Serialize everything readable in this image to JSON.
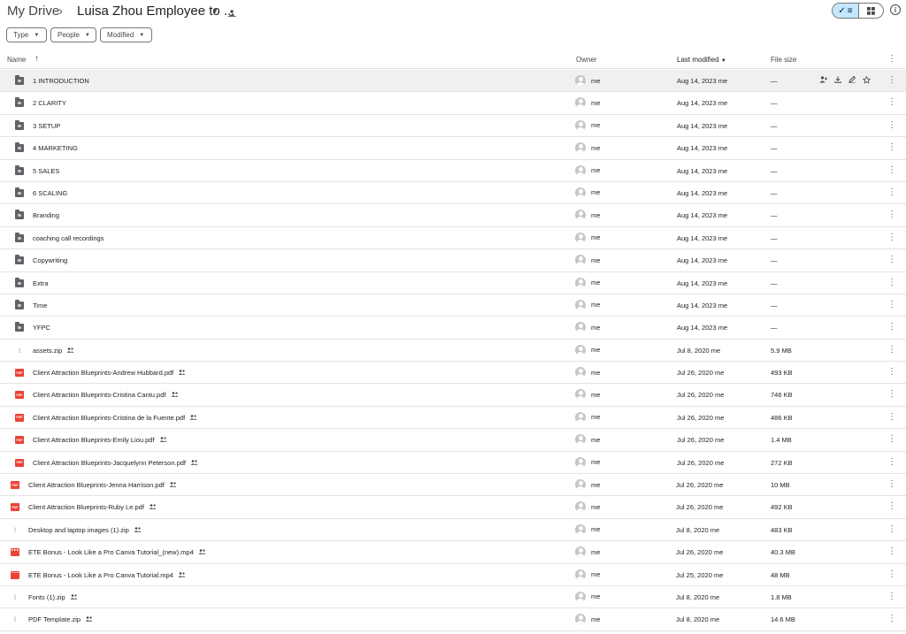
{
  "breadcrumb": {
    "root": "My Drive",
    "separator": "›",
    "current": "Luisa Zhou Employee to ..."
  },
  "filters": {
    "type": "Type",
    "people": "People",
    "modified": "Modified"
  },
  "columns": {
    "name": "Name",
    "owner": "Owner",
    "last_modified": "Last modified",
    "file_size": "File size"
  },
  "icons": {
    "sort_arrow": "arrow-up-icon",
    "more": "more-vert-icon",
    "shared": "shared-people-icon",
    "info": "info-icon"
  },
  "colors": {
    "accent": "#c2e7ff",
    "pdf_red": "#ea4335",
    "folder_gray": "#5f6368"
  },
  "rows": [
    {
      "type": "folder",
      "name": "1 INTRODUCTION",
      "owner": "me",
      "modified": "Aug 14, 2023 me",
      "size": "—",
      "shared": false
    },
    {
      "type": "folder",
      "name": "2 CLARITY",
      "owner": "me",
      "modified": "Aug 14, 2023 me",
      "size": "—",
      "shared": false
    },
    {
      "type": "folder",
      "name": "3 SETUP",
      "owner": "me",
      "modified": "Aug 14, 2023 me",
      "size": "—",
      "shared": false
    },
    {
      "type": "folder",
      "name": "4 MARKETING",
      "owner": "me",
      "modified": "Aug 14, 2023 me",
      "size": "—",
      "shared": false
    },
    {
      "type": "folder",
      "name": "5 SALES",
      "owner": "me",
      "modified": "Aug 14, 2023 me",
      "size": "—",
      "shared": false
    },
    {
      "type": "folder",
      "name": "6 SCALING",
      "owner": "me",
      "modified": "Aug 14, 2023 me",
      "size": "—",
      "shared": false
    },
    {
      "type": "folder",
      "name": "Branding",
      "owner": "me",
      "modified": "Aug 14, 2023 me",
      "size": "—",
      "shared": false
    },
    {
      "type": "folder",
      "name": "coaching call recordings",
      "owner": "me",
      "modified": "Aug 14, 2023 me",
      "size": "—",
      "shared": false
    },
    {
      "type": "folder",
      "name": "Copywriting",
      "owner": "me",
      "modified": "Aug 14, 2023 me",
      "size": "—",
      "shared": false
    },
    {
      "type": "folder",
      "name": "Extra",
      "owner": "me",
      "modified": "Aug 14, 2023 me",
      "size": "—",
      "shared": false
    },
    {
      "type": "folder",
      "name": "Time",
      "owner": "me",
      "modified": "Aug 14, 2023 me",
      "size": "—",
      "shared": false
    },
    {
      "type": "folder",
      "name": "YFPC",
      "owner": "me",
      "modified": "Aug 14, 2023 me",
      "size": "—",
      "shared": false
    },
    {
      "type": "zip",
      "name": "assets.zip",
      "owner": "me",
      "modified": "Jul 8, 2020 me",
      "size": "5.9 MB",
      "shared": true
    },
    {
      "type": "pdf",
      "name": "Client Attraction Blueprints-Andrew Hubbard.pdf",
      "owner": "me",
      "modified": "Jul 26, 2020 me",
      "size": "493 KB",
      "shared": true
    },
    {
      "type": "pdf",
      "name": "Client Attraction Blueprints-Cristina Cantu.pdf",
      "owner": "me",
      "modified": "Jul 26, 2020 me",
      "size": "746 KB",
      "shared": true
    },
    {
      "type": "pdf",
      "name": "Client Attraction Blueprints-Cristina de la Fuente.pdf",
      "owner": "me",
      "modified": "Jul 26, 2020 me",
      "size": "486 KB",
      "shared": true
    },
    {
      "type": "pdf",
      "name": "Client Attraction Blueprints-Emily Liou.pdf",
      "owner": "me",
      "modified": "Jul 26, 2020 me",
      "size": "1.4 MB",
      "shared": true
    },
    {
      "type": "pdf",
      "name": "Client Attraction Blueprints-Jacquelynn Peterson.pdf",
      "owner": "me",
      "modified": "Jul 26, 2020 me",
      "size": "272 KB",
      "shared": true
    },
    {
      "type": "pdf",
      "name": "Client Attraction Blueprints-Jenna Harrison.pdf",
      "owner": "me",
      "modified": "Jul 26, 2020 me",
      "size": "10 MB",
      "shared": true
    },
    {
      "type": "pdf",
      "name": "Client Attraction Blueprints-Ruby Le.pdf",
      "owner": "me",
      "modified": "Jul 26, 2020 me",
      "size": "492 KB",
      "shared": true
    },
    {
      "type": "zip",
      "name": "Desktop and laptop images (1).zip",
      "owner": "me",
      "modified": "Jul 8, 2020 me",
      "size": "483 KB",
      "shared": true
    },
    {
      "type": "video",
      "name": "ETE Bonus - Look Like a Pro Canva Tutorial_(new).mp4",
      "owner": "me",
      "modified": "Jul 26, 2020 me",
      "size": "40.3 MB",
      "shared": true
    },
    {
      "type": "video",
      "name": "ETE Bonus - Look Like a Pro Canva Tutorial.mp4",
      "owner": "me",
      "modified": "Jul 25, 2020 me",
      "size": "48 MB",
      "shared": true
    },
    {
      "type": "zip",
      "name": "Fonts (1).zip",
      "owner": "me",
      "modified": "Jul 8, 2020 me",
      "size": "1.8 MB",
      "shared": true
    },
    {
      "type": "zip",
      "name": "PDF Template.zip",
      "owner": "me",
      "modified": "Jul 8, 2020 me",
      "size": "14.6 MB",
      "shared": true
    }
  ]
}
